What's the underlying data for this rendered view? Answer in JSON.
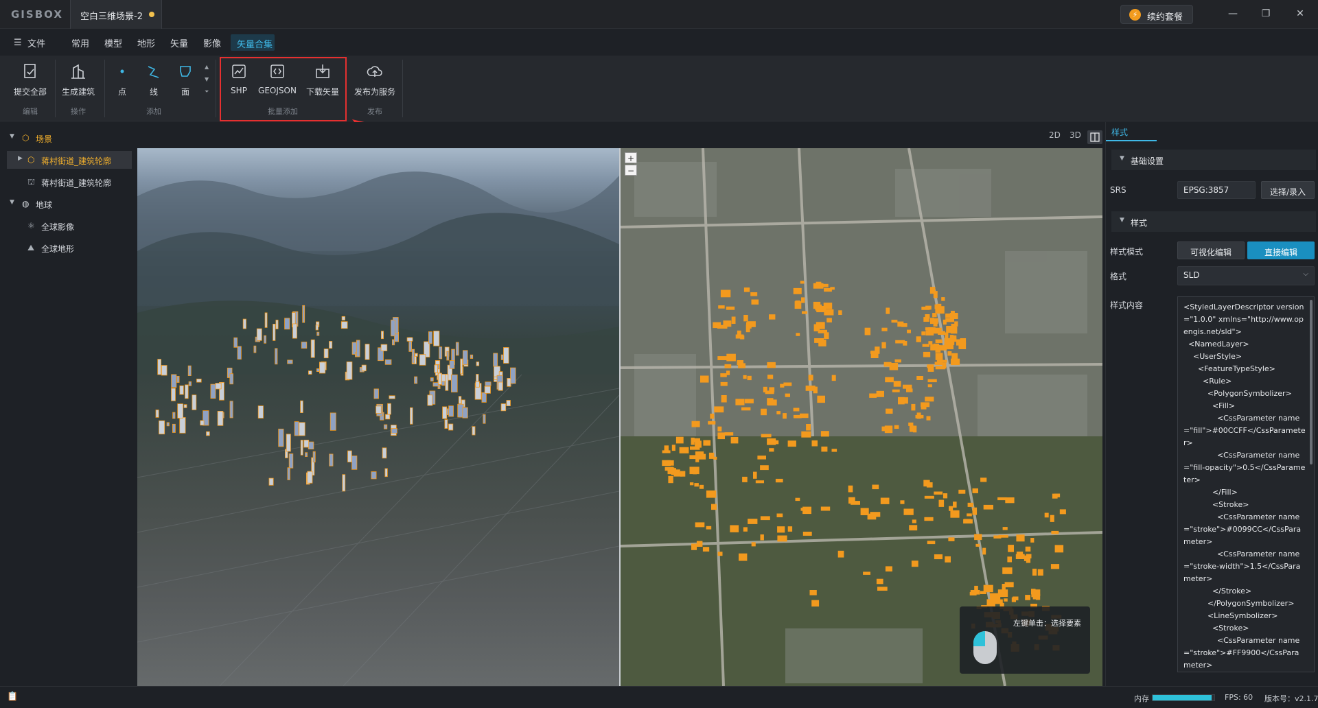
{
  "app": {
    "logo": "GISBOX",
    "tab_title": "空白三维场景-2",
    "renew_label": "续约套餐"
  },
  "window_controls": {
    "minimize": "—",
    "restore": "❐",
    "close": "✕"
  },
  "menu": {
    "file": "文件",
    "items": [
      "常用",
      "模型",
      "地形",
      "矢量",
      "影像"
    ],
    "active": "矢量合集"
  },
  "ribbon": {
    "submit_all": "提交全部",
    "generate_building": "生成建筑",
    "point": "点",
    "line": "线",
    "polygon": "面",
    "shp": "SHP",
    "geojson": "GEOJSON",
    "download_vector": "下载矢量",
    "publish_service": "发布为服务",
    "groups": {
      "edit": "编辑",
      "operate": "操作",
      "add": "添加",
      "batch_add": "批量添加",
      "publish": "发布"
    }
  },
  "tree": {
    "scene": "场景",
    "layer_selected": "蒋村街道_建筑轮廓",
    "layer_child": "蒋村街道_建筑轮廓",
    "globe": "地球",
    "global_imagery": "全球影像",
    "global_terrain": "全球地形"
  },
  "view_modes": {
    "mode_2d": "2D",
    "mode_3d": "3D"
  },
  "zoom": {
    "in": "+",
    "out": "−"
  },
  "tooltip": {
    "text": "左键单击：选择要素"
  },
  "style_panel": {
    "tab": "样式",
    "basic_section": "基础设置",
    "srs_label": "SRS",
    "srs_value": "EPSG:3857",
    "select_button": "选择/录入",
    "style_section": "样式",
    "mode_label": "样式模式",
    "visual_edit": "可视化编辑",
    "direct_edit": "直接编辑",
    "format_label": "格式",
    "format_value": "SLD",
    "content_label": "样式内容",
    "content": "<StyledLayerDescriptor version=\"1.0.0\" xmlns=\"http://www.opengis.net/sld\">\n  <NamedLayer>\n    <UserStyle>\n      <FeatureTypeStyle>\n        <Rule>\n          <PolygonSymbolizer>\n            <Fill>\n              <CssParameter name=\"fill\">#00CCFF</CssParameter>\n              <CssParameter name=\"fill-opacity\">0.5</CssParameter>\n            </Fill>\n            <Stroke>\n              <CssParameter name=\"stroke\">#0099CC</CssParameter>\n              <CssParameter name=\"stroke-width\">1.5</CssParameter>\n            </Stroke>\n          </PolygonSymbolizer>\n          <LineSymbolizer>\n            <Stroke>\n              <CssParameter name=\"stroke\">#FF9900</CssParameter>"
  },
  "status": {
    "memory_label": "内存",
    "memory_fraction": 0.95,
    "fps": "FPS: 60",
    "version": "版本号：v2.1.7"
  },
  "colors": {
    "accent": "#3fb8e6",
    "selected_layer": "#f2b02d",
    "highlight_box": "#e53030",
    "building_fill": "#f39a1e"
  }
}
